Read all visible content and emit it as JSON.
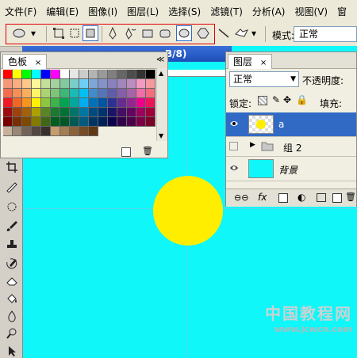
{
  "menu": [
    "文件(F)",
    "编辑(E)",
    "图像(I)",
    "图层(L)",
    "选择(S)",
    "滤镜(T)",
    "分析(A)",
    "视图(V)",
    "窗"
  ],
  "options": {
    "mode_label": "模式:",
    "mode_value": "正常"
  },
  "canvas": {
    "title_fragment": "B/8)",
    "watermark_cn": "中国教程网",
    "watermark_url": "www.jcwcn.com"
  },
  "swatches": {
    "tab": "色板",
    "rows": [
      [
        "#ff0000",
        "#ffff00",
        "#00ff00",
        "#00ffff",
        "#0000ff",
        "#ff00ff",
        "#ffffff",
        "#e6e6e6",
        "#cccccc",
        "#b3b3b3",
        "#999999",
        "#808080",
        "#666666",
        "#4d4d4d",
        "#333333",
        "#000000"
      ],
      [
        "#f7977a",
        "#f9ad81",
        "#fdc68a",
        "#fff79a",
        "#c4df9b",
        "#a3d39c",
        "#82ca9d",
        "#7bcdc8",
        "#6ecff6",
        "#7ea7d8",
        "#8493ca",
        "#8882be",
        "#a187be",
        "#bc8dbf",
        "#f49ac2",
        "#f6989d"
      ],
      [
        "#f26c4f",
        "#f68e56",
        "#fbaf5d",
        "#fff568",
        "#acd372",
        "#7cc576",
        "#3bb878",
        "#1abbb4",
        "#00bff3",
        "#438ccb",
        "#5574b9",
        "#605ca8",
        "#855fa8",
        "#a763a8",
        "#f06ea9",
        "#f26d7d"
      ],
      [
        "#ed1c24",
        "#f26522",
        "#f7941d",
        "#fff200",
        "#8dc73f",
        "#39b54a",
        "#00a651",
        "#00a99d",
        "#00aeef",
        "#0072bc",
        "#0054a6",
        "#2e3192",
        "#662d91",
        "#92278f",
        "#ec008c",
        "#ed145b"
      ],
      [
        "#9e0b0f",
        "#a0410d",
        "#a3620a",
        "#aba000",
        "#598527",
        "#1a7b30",
        "#007236",
        "#00746b",
        "#0076a3",
        "#004b80",
        "#003471",
        "#1b1464",
        "#440e62",
        "#630460",
        "#9e005d",
        "#9e0039"
      ],
      [
        "#790000",
        "#7b2e00",
        "#7d4900",
        "#827b00",
        "#406618",
        "#005e20",
        "#005826",
        "#005952",
        "#005b7f",
        "#003663",
        "#002157",
        "#0d004c",
        "#32004b",
        "#4b0049",
        "#7b0046",
        "#7a0026"
      ],
      [
        "#c7b299",
        "#998675",
        "#736357",
        "#534741",
        "#37302d",
        "#c69c6d",
        "#a67c52",
        "#8c6239",
        "#754c24",
        "#603913"
      ]
    ]
  },
  "layers": {
    "tab": "图层",
    "blend_mode": "正常",
    "opacity_label": "不透明度:",
    "lock_label": "锁定:",
    "fill_label": "填充:",
    "items": [
      {
        "name": "a",
        "selected": true,
        "visible": true
      },
      {
        "name": "组 2",
        "selected": false,
        "visible": false
      },
      {
        "name": "背景",
        "selected": false,
        "visible": true
      }
    ]
  }
}
